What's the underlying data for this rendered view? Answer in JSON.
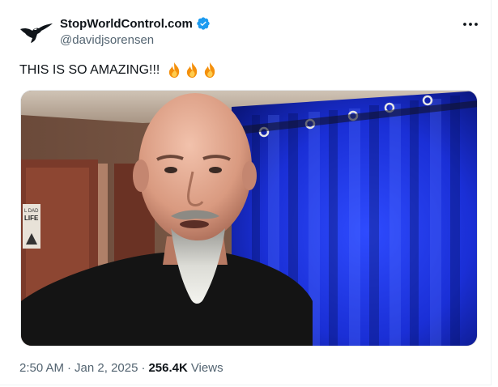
{
  "tweet": {
    "display_name": "StopWorldControl.com",
    "handle": "@davidjsorensen",
    "text": "THIS IS SO AMAZING!!!",
    "emojis": [
      "fire-emoji",
      "fire-emoji",
      "fire-emoji"
    ],
    "verified": true,
    "media": {
      "type": "video-frame",
      "poster_text": [
        "L DAD",
        "LIFE"
      ]
    },
    "time": "2:50 AM",
    "date": "Jan 2, 2025",
    "views_count": "256.4K",
    "views_label": "Views",
    "separator": "·"
  },
  "icons": {
    "avatar": "eagle-logo-icon",
    "verified": "verified-badge-icon",
    "more": "more-options-icon"
  },
  "colors": {
    "verified": "#1d9bf0",
    "secondary_text": "#536471",
    "primary_text": "#0f1419",
    "curtain_blue": "#1a2fd6"
  }
}
